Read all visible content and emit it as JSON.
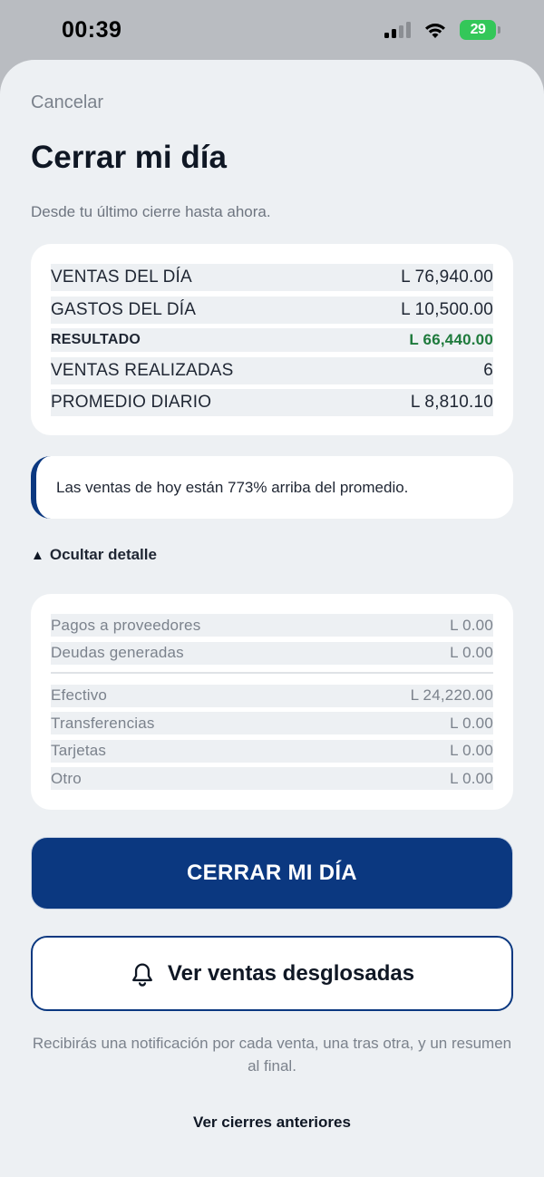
{
  "status_bar": {
    "time": "00:39",
    "battery": "29"
  },
  "header": {
    "cancel_label": "Cancelar",
    "title": "Cerrar mi día",
    "subtitle": "Desde tu último cierre hasta ahora."
  },
  "summary": {
    "rows": [
      {
        "label": "VENTAS DEL DÍA",
        "value": "L 76,940.00"
      },
      {
        "label": "GASTOS DEL DÍA",
        "value": "L 10,500.00"
      },
      {
        "label": "RESULTADO",
        "value": "L 66,440.00"
      },
      {
        "label": "VENTAS REALIZADAS",
        "value": "6"
      },
      {
        "label": "PROMEDIO DIARIO",
        "value": "L 8,810.10"
      }
    ]
  },
  "alert": {
    "text": "Las ventas de hoy están 773% arriba del promedio."
  },
  "detail_toggle": {
    "label": "Ocultar detalle"
  },
  "detail": {
    "group1": [
      {
        "label": "Pagos a proveedores",
        "value": "L 0.00"
      },
      {
        "label": "Deudas generadas",
        "value": "L 0.00"
      }
    ],
    "group2": [
      {
        "label": "Efectivo",
        "value": "L 24,220.00"
      },
      {
        "label": "Transferencias",
        "value": "L 0.00"
      },
      {
        "label": "Tarjetas",
        "value": "L 0.00"
      },
      {
        "label": "Otro",
        "value": "L 0.00"
      }
    ]
  },
  "actions": {
    "close_day_label": "CERRAR MI DÍA",
    "view_sales_label": "Ver ventas desglosadas"
  },
  "note": "Recibirás una notificación por cada venta, una tras otra, y un resumen al final.",
  "history_link": "Ver cierres anteriores",
  "colors": {
    "primary": "#0b3880",
    "positive": "#1e7a3c",
    "background": "#edf0f3",
    "battery": "#34c759"
  },
  "icons": {
    "view_sales": "bell-icon",
    "toggle": "triangle-up-icon"
  }
}
